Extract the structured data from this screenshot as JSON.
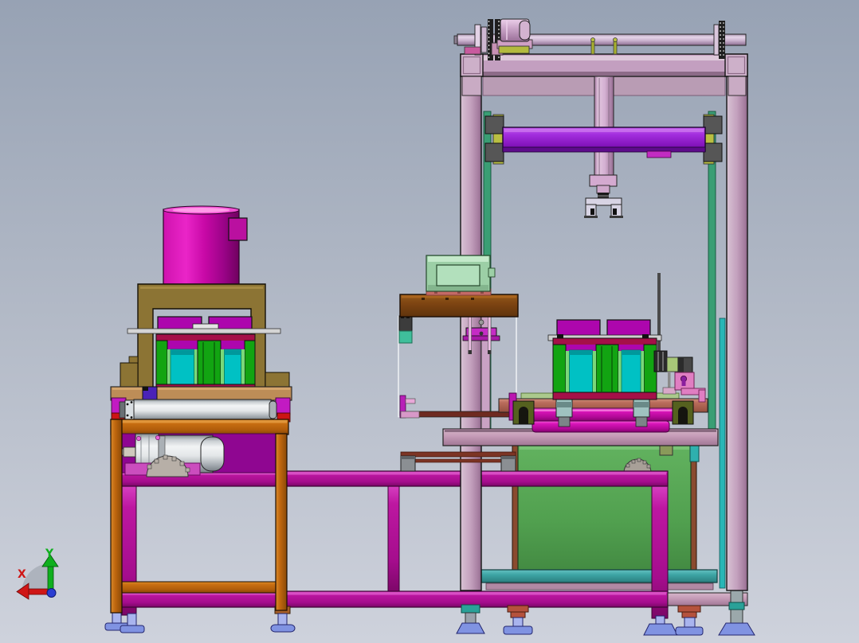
{
  "view": {
    "type": "cad-3d-viewport-front-view",
    "background": {
      "top": "#97a2b4",
      "bottom": "#ced2dc"
    },
    "axis_triad": {
      "x_label": "X",
      "y_label": "Y",
      "x_color": "#cf1616",
      "y_color": "#0faf1e",
      "origin_color": "#2b3ed2",
      "shadow_color": "#a8aeb8"
    }
  },
  "machine": {
    "left_station": {
      "label": "left-press-station",
      "parts": [
        "magenta-cylinder-actuator",
        "actuator-side-block",
        "olive-c-frame",
        "upper-die-blocks",
        "center-slide-plate",
        "crimson-clamp-bars",
        "green-die-frame",
        "cyan-die-inserts",
        "tan-base-plate",
        "purple-stop-block",
        "guide-roller",
        "roller-bearing-flange",
        "orange-table-beam",
        "magenta-motor-panel",
        "drive-motor",
        "motor-base",
        "drive-gear",
        "orange-legs",
        "orange-lower-rail"
      ]
    },
    "center_unit": {
      "label": "transfer-column-unit",
      "parts": [
        "mint-control-box",
        "control-box-window",
        "dusty-red-pad",
        "brown-platform",
        "dark-sensor-block",
        "teal-sensor-block",
        "support-column",
        "magenta-t-bracket",
        "guide-rods",
        "thin-panel-outline",
        "maroon-rails",
        "gray-rail-blocks"
      ]
    },
    "gantry_station": {
      "label": "gantry-press-station",
      "parts": [
        "top-drive-shaft",
        "shaft-flanges",
        "black-sprockets",
        "shaft-motor-drum",
        "top-beam",
        "rear-top-beam",
        "left-leg",
        "right-leg",
        "green-guide-rails",
        "yellow-slide-strips",
        "gray-slider-blocks",
        "purple-lift-crossbeam",
        "press-column",
        "press-cap",
        "gripper-fork",
        "upper-die-blocks",
        "slide-plate",
        "crimson-clamp-bars",
        "green-die-frame",
        "cyan-die-inserts",
        "rosy-conveyor-rail",
        "magenta-rollers",
        "bearing-blocks",
        "olive-slot-brackets",
        "side-motor-unit",
        "disc-stack",
        "pink-bracket",
        "green-cabinet",
        "cabinet-olive-box",
        "cabinet-teal-tab",
        "cabinet-gear",
        "teal-base-beam",
        "mauve-table-beam",
        "mauve-bottom-beam",
        "cyan-leg-strip"
      ]
    },
    "base_frame": {
      "label": "floor-frame",
      "parts": [
        "magenta-top-long-beam",
        "magenta-bottom-long-beam",
        "magenta-posts",
        "leveling-feet"
      ]
    },
    "feet": {
      "count": 8,
      "pad_color": "#8093e2",
      "stem_color": "#a9b4ee",
      "teal_cap_color": "#2aa198",
      "brick_cap_color": "#b5523c"
    }
  },
  "palette": {
    "frame_lavender": "#c3a0bd",
    "beam_purple": "#8f16c6",
    "magenta_beam": "#b5129b",
    "bright_magenta": "#d914ba",
    "crimson": "#a51048",
    "die_green": "#12a412",
    "die_cyan": "#00c1c4",
    "olive_frame": "#8c7434",
    "table_orange": "#bf660e",
    "cabinet_green": "#51a04f",
    "teal_beam": "#3da4a4",
    "mint_box": "#9ccfa6",
    "platform_brown": "#7e4512",
    "metal_silver": "#e3e6e8"
  }
}
